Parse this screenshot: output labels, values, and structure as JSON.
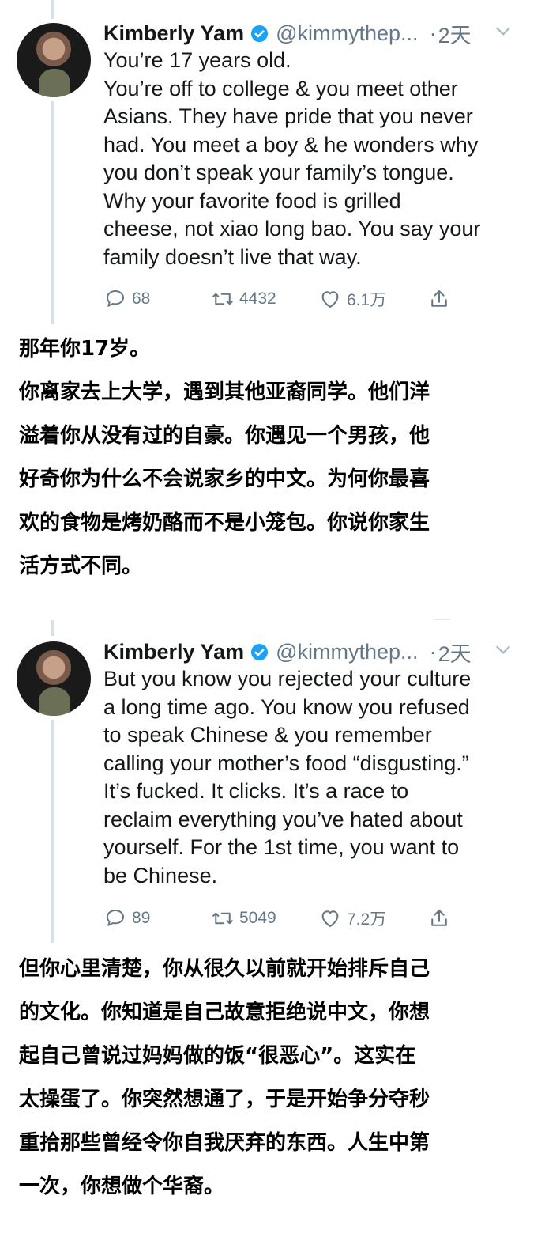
{
  "tweets": [
    {
      "name": "Kimberly Yam",
      "handle": "@kimmythep...",
      "dot": "·",
      "time": "2天",
      "lines": [
        "You’re 17 years old.",
        "You’re off to college & you meet other",
        "Asians. They have pride that you never",
        "had. You meet a boy & he wonders why",
        "you don’t speak your family’s tongue.",
        "Why your favorite food is grilled",
        "cheese, not xiao long bao. You say your",
        "family doesn’t live that way."
      ],
      "replies": "68",
      "retweets": "4432",
      "likes": "6.1万"
    },
    {
      "name": "Kimberly Yam",
      "handle": "@kimmythep...",
      "dot": "·",
      "time": "2天",
      "lines": [
        "But you know you rejected your culture",
        "a long time ago. You know you refused",
        "to speak Chinese & you remember",
        "calling your mother’s food “disgusting.”",
        "It’s fucked. It clicks. It’s a race to",
        "reclaim everything you’ve hated about",
        "yourself. For the 1st time, you want to",
        "be Chinese."
      ],
      "replies": "89",
      "retweets": "5049",
      "likes": "7.2万"
    }
  ],
  "translations": [
    {
      "lines": [
        "那年你17岁。",
        "你离家去上大学，遇到其他亚裔同学。他们洋",
        "溢着你从没有过的自豪。你遇见一个男孩，他",
        "好奇你为什么不会说家乡的中文。为何你最喜",
        "欢的食物是烤奶酪而不是小笼包。你说你家生",
        "活方式不同。"
      ]
    },
    {
      "lines": [
        "但你心里清楚，你从很久以前就开始排斥自己",
        "的文化。你知道是自己故意拒绝说中文，你想",
        "起自己曾说过妈妈做的饭“很恶心”。这实在",
        "太操蛋了。你突然想通了，于是开始争分夺秒",
        "重拾那些曾经令你自我厌弃的东西。人生中第",
        "一次，你想做个华裔。"
      ]
    }
  ],
  "colors": {
    "verified": "#1da1f2",
    "muted": "#657786",
    "text": "#14171a",
    "thread_line": "#d8dfe5"
  },
  "icons": {
    "reply": "reply-icon",
    "retweet": "retweet-icon",
    "like": "heart-icon",
    "share": "share-icon",
    "verified": "verified-badge-icon",
    "menu": "chevron-down-icon"
  }
}
